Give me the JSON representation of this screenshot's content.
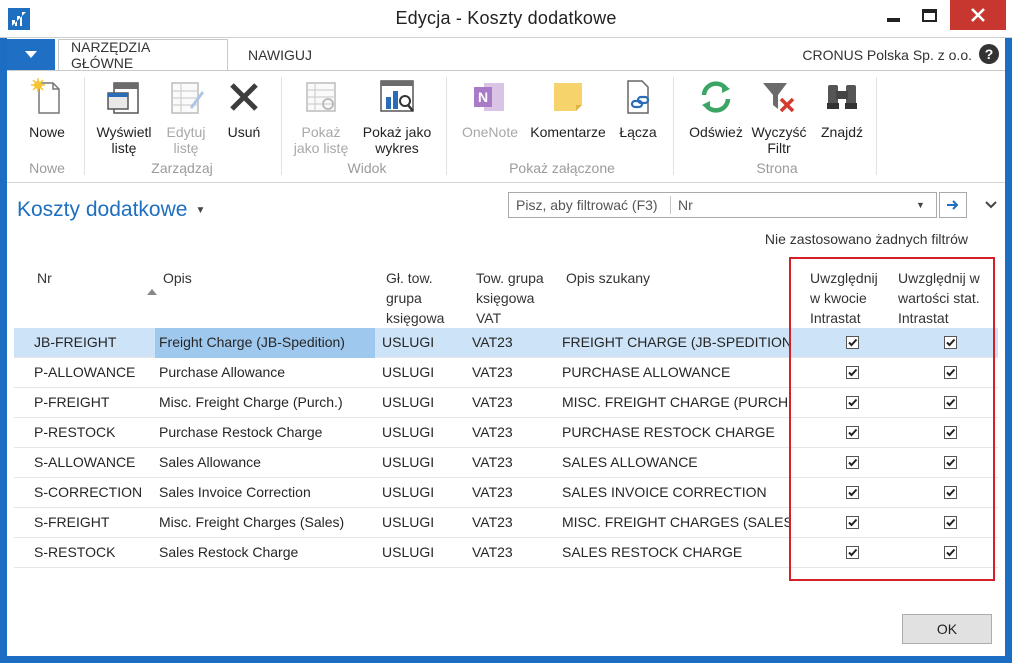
{
  "window": {
    "title": "Edycja - Koszty dodatkowe"
  },
  "ribbon": {
    "tabs": [
      {
        "label": "NARZĘDZIA GŁÓWNE"
      },
      {
        "label": "NAWIGUJ"
      }
    ],
    "company": "CRONUS Polska Sp. z o.o.",
    "help": "?",
    "buttons": {
      "nowe": "Nowe",
      "wyswietl_1": "Wyświetl",
      "wyswietl_2": "listę",
      "edytuj_1": "Edytuj",
      "edytuj_2": "listę",
      "usun": "Usuń",
      "pokaz_liste_1": "Pokaż",
      "pokaz_liste_2": "jako listę",
      "pokaz_wykres_1": "Pokaż jako",
      "pokaz_wykres_2": "wykres",
      "onenote": "OneNote",
      "komentarze": "Komentarze",
      "lacza": "Łącza",
      "odswiez": "Odśwież",
      "wyczysc_1": "Wyczyść",
      "wyczysc_2": "Filtr",
      "znajdz": "Znajdź"
    },
    "groups": {
      "nowe": "Nowe",
      "zarzadzaj": "Zarządzaj",
      "widok": "Widok",
      "zalaczone": "Pokaż załączone",
      "strona": "Strona"
    }
  },
  "page": {
    "title": "Koszty dodatkowe",
    "filter_placeholder": "Pisz, aby filtrować (F3)",
    "filter_field": "Nr",
    "no_filters": "Nie zastosowano żadnych filtrów"
  },
  "table": {
    "headers": {
      "nr": "Nr",
      "opis": "Opis",
      "gl_1": "Gł. tow.",
      "gl_2": "grupa",
      "gl_3": "księgowa",
      "tow_1": "Tow. grupa",
      "tow_2": "księgowa",
      "tow_3": "VAT",
      "szukany": "Opis szukany",
      "kwota_1": "Uwzględnij",
      "kwota_2": "w kwocie",
      "kwota_3": "Intrastat",
      "wart_1": "Uwzględnij w",
      "wart_2": "wartości stat.",
      "wart_3": "Intrastat"
    },
    "rows": [
      {
        "nr": "JB-FREIGHT",
        "opis": "Freight Charge (JB-Spedition)",
        "gl": "USLUGI",
        "vat": "VAT23",
        "szukany": "FREIGHT CHARGE (JB-SPEDITION)",
        "kwota": true,
        "wart": true
      },
      {
        "nr": "P-ALLOWANCE",
        "opis": "Purchase Allowance",
        "gl": "USLUGI",
        "vat": "VAT23",
        "szukany": "PURCHASE ALLOWANCE",
        "kwota": true,
        "wart": true
      },
      {
        "nr": "P-FREIGHT",
        "opis": "Misc. Freight Charge (Purch.)",
        "gl": "USLUGI",
        "vat": "VAT23",
        "szukany": "MISC. FREIGHT CHARGE (PURCH.)",
        "kwota": true,
        "wart": true
      },
      {
        "nr": "P-RESTOCK",
        "opis": "Purchase Restock Charge",
        "gl": "USLUGI",
        "vat": "VAT23",
        "szukany": "PURCHASE RESTOCK CHARGE",
        "kwota": true,
        "wart": true
      },
      {
        "nr": "S-ALLOWANCE",
        "opis": "Sales Allowance",
        "gl": "USLUGI",
        "vat": "VAT23",
        "szukany": "SALES ALLOWANCE",
        "kwota": true,
        "wart": true
      },
      {
        "nr": "S-CORRECTION",
        "opis": "Sales Invoice Correction",
        "gl": "USLUGI",
        "vat": "VAT23",
        "szukany": "SALES INVOICE CORRECTION",
        "kwota": true,
        "wart": true
      },
      {
        "nr": "S-FREIGHT",
        "opis": "Misc. Freight Charges (Sales)",
        "gl": "USLUGI",
        "vat": "VAT23",
        "szukany": "MISC. FREIGHT CHARGES (SALES)",
        "kwota": true,
        "wart": true
      },
      {
        "nr": "S-RESTOCK",
        "opis": "Sales Restock Charge",
        "gl": "USLUGI",
        "vat": "VAT23",
        "szukany": "SALES RESTOCK CHARGE",
        "kwota": true,
        "wart": true
      }
    ]
  },
  "footer": {
    "ok": "OK"
  },
  "colors": {
    "accent": "#1b6ec2",
    "title_blue": "#1e6fbf",
    "selected_row": "#cde3f7",
    "highlight_border": "#d42027",
    "close_button": "#c7372f"
  }
}
